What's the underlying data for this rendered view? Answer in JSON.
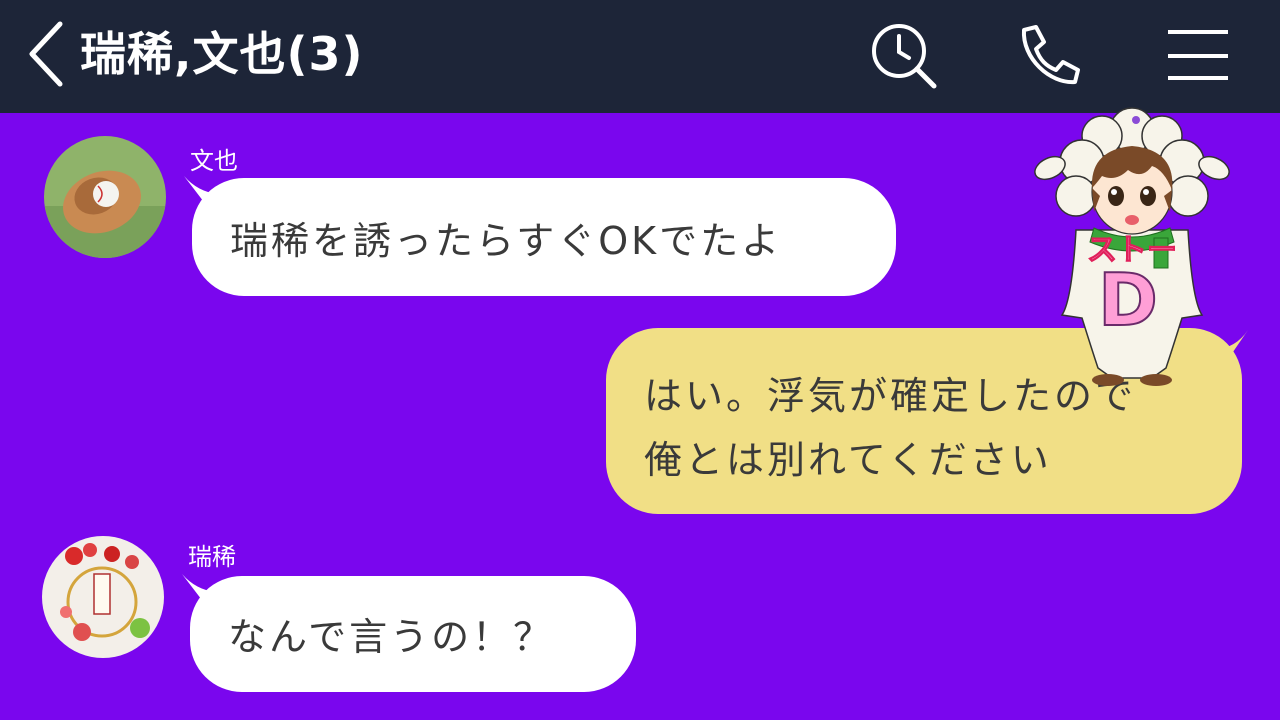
{
  "header": {
    "title": "瑞稀,文也(3)",
    "icons": [
      "back-chevron-icon",
      "search-clock-icon",
      "phone-icon",
      "menu-icon"
    ]
  },
  "messages": [
    {
      "sender": "文也",
      "text": "瑞稀を誘ったらすぐOKでたよ",
      "side": "left"
    },
    {
      "lines": [
        "はい。浮気が確定したので",
        "俺とは別れてください"
      ],
      "side": "right"
    },
    {
      "sender": "瑞稀",
      "text": "なんで言うの！？",
      "side": "left"
    }
  ],
  "overlay": {
    "sign_text": "ストー",
    "logo_letter": "D"
  },
  "colors": {
    "header_bg": "#1d2538",
    "chat_bg": "#7a06ee",
    "incoming_bubble": "#ffffff",
    "outgoing_bubble": "#f1df86"
  }
}
